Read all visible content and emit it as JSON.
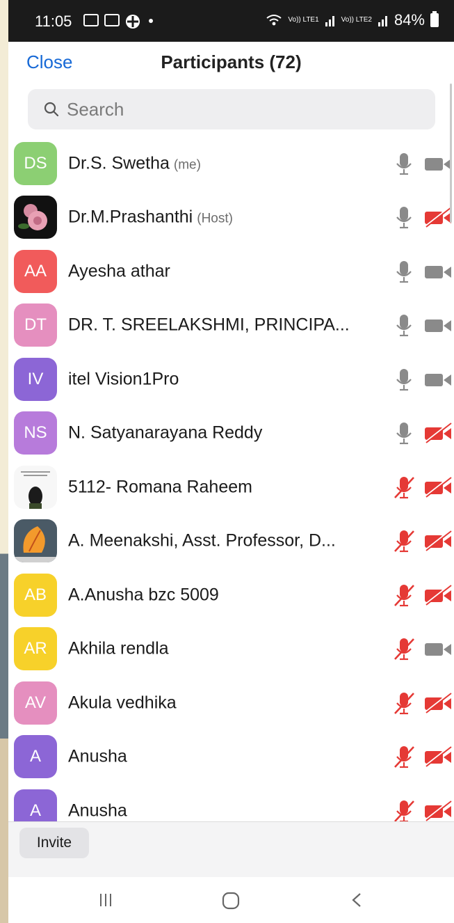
{
  "status_bar": {
    "time": "11:05",
    "network1": "Vo)) LTE1",
    "network2": "Vo)) LTE2",
    "battery": "84%"
  },
  "header": {
    "close_label": "Close",
    "title": "Participants (72)"
  },
  "search": {
    "placeholder": "Search"
  },
  "participants": [
    {
      "initials": "DS",
      "name": "Dr.S. Swetha",
      "role": "(me)",
      "avatar_color": "#8ccf73",
      "mic": "on",
      "video": "on"
    },
    {
      "initials": "",
      "name": "Dr.M.Prashanthi",
      "role": "(Host)",
      "avatar_image": "rose photo",
      "mic": "on",
      "video": "off"
    },
    {
      "initials": "AA",
      "name": "Ayesha athar",
      "role": "",
      "avatar_color": "#f15b5b",
      "mic": "on",
      "video": "on"
    },
    {
      "initials": "DT",
      "name": "DR. T. SREELAKSHMI, PRINCIPA...",
      "role": "",
      "avatar_color": "#e58fbf",
      "mic": "on",
      "video": "on"
    },
    {
      "initials": "IV",
      "name": "itel Vision1Pro",
      "role": "",
      "avatar_color": "#8c66d6",
      "mic": "on",
      "video": "on"
    },
    {
      "initials": "NS",
      "name": "N. Satyanarayana Reddy",
      "role": "",
      "avatar_color": "#b77bdb",
      "mic": "on",
      "video": "off"
    },
    {
      "initials": "",
      "name": "5112- Romana Raheem",
      "role": "",
      "avatar_image": "quote card photo",
      "mic": "off",
      "video": "off"
    },
    {
      "initials": "",
      "name": "A. Meenakshi, Asst. Professor, D...",
      "role": "",
      "avatar_image": "autumn leaf photo",
      "mic": "off",
      "video": "off"
    },
    {
      "initials": "AB",
      "name": "A.Anusha bzc 5009",
      "role": "",
      "avatar_color": "#f7d12a",
      "mic": "off",
      "video": "off"
    },
    {
      "initials": "AR",
      "name": "Akhila rendla",
      "role": "",
      "avatar_color": "#f7d12a",
      "mic": "off",
      "video": "on"
    },
    {
      "initials": "AV",
      "name": "Akula vedhika",
      "role": "",
      "avatar_color": "#e58fbf",
      "mic": "off",
      "video": "off"
    },
    {
      "initials": "A",
      "name": "Anusha",
      "role": "",
      "avatar_color": "#8c66d6",
      "mic": "off",
      "video": "off"
    },
    {
      "initials": "A",
      "name": "Anusha",
      "role": "",
      "avatar_color": "#8c66d6",
      "mic": "off",
      "video": "off"
    }
  ],
  "footer": {
    "invite_label": "Invite"
  },
  "nav": {
    "icons": [
      "recent-apps-icon",
      "home-icon",
      "back-icon"
    ]
  },
  "colors": {
    "accent": "#1769d6",
    "muted_red": "#e53935",
    "icon_gray": "#8a8a8a"
  }
}
